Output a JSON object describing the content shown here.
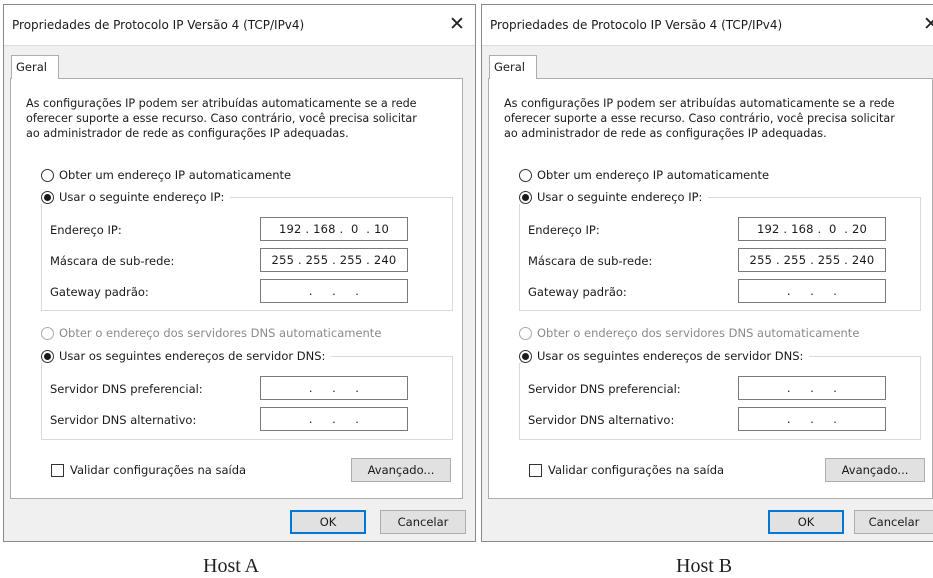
{
  "dialogs": [
    {
      "title": "Propriedades de Protocolo IP Versão 4 (TCP/IPv4)",
      "close_glyph": "✕",
      "tab_label": "Geral",
      "description": [
        "As configurações IP podem ser atribuídas automaticamente se a rede",
        "oferecer suporte a esse recurso. Caso contrário, você precisa solicitar",
        "ao administrador de rede as configurações IP adequadas."
      ],
      "ip_auto_label": "Obter um endereço IP automaticamente",
      "ip_manual_label": "Usar o seguinte endereço IP:",
      "ip_address_label": "Endereço IP:",
      "ip_address_value": "192 . 168 .  0  . 10",
      "subnet_label": "Máscara de sub-rede:",
      "subnet_value": "255 . 255 . 255 . 240",
      "gateway_label": "Gateway padrão:",
      "gateway_value": "  .     .     .  ",
      "dns_auto_label": "Obter o endereço dos servidores DNS automaticamente",
      "dns_manual_label": "Usar os seguintes endereços de servidor DNS:",
      "dns_pref_label": "Servidor DNS preferencial:",
      "dns_pref_value": "  .     .     .  ",
      "dns_alt_label": "Servidor DNS alternativo:",
      "dns_alt_value": "  .     .     .  ",
      "validate_label": "Validar configurações na saída",
      "advanced_label": "Avançado...",
      "ok_label": "OK",
      "cancel_label": "Cancelar",
      "ip_mode": "manual",
      "dns_mode": "manual",
      "validate_checked": false
    },
    {
      "title": "Propriedades de Protocolo IP Versão 4 (TCP/IPv4)",
      "close_glyph": "✕",
      "tab_label": "Geral",
      "description": [
        "As configurações IP podem ser atribuídas automaticamente se a rede",
        "oferecer suporte a esse recurso. Caso contrário, você precisa solicitar",
        "ao administrador de rede as configurações IP adequadas."
      ],
      "ip_auto_label": "Obter um endereço IP automaticamente",
      "ip_manual_label": "Usar o seguinte endereço IP:",
      "ip_address_label": "Endereço IP:",
      "ip_address_value": "192 . 168 .  0  . 20",
      "subnet_label": "Máscara de sub-rede:",
      "subnet_value": "255 . 255 . 255 . 240",
      "gateway_label": "Gateway padrão:",
      "gateway_value": "  .     .     .  ",
      "dns_auto_label": "Obter o endereço dos servidores DNS automaticamente",
      "dns_manual_label": "Usar os seguintes endereços de servidor DNS:",
      "dns_pref_label": "Servidor DNS preferencial:",
      "dns_pref_value": "  .     .     .  ",
      "dns_alt_label": "Servidor DNS alternativo:",
      "dns_alt_value": "  .     .     .  ",
      "validate_label": "Validar configurações na saída",
      "advanced_label": "Avançado...",
      "ok_label": "OK",
      "cancel_label": "Cancelar",
      "ip_mode": "manual",
      "dns_mode": "manual",
      "validate_checked": false
    }
  ],
  "captions": [
    "Host A",
    "Host B"
  ],
  "colors": {
    "dialog_bg": "#f0f0f0",
    "panel_bg": "#ffffff",
    "default_button_border": "#0078d7",
    "disabled_text": "#8a8a8a"
  }
}
